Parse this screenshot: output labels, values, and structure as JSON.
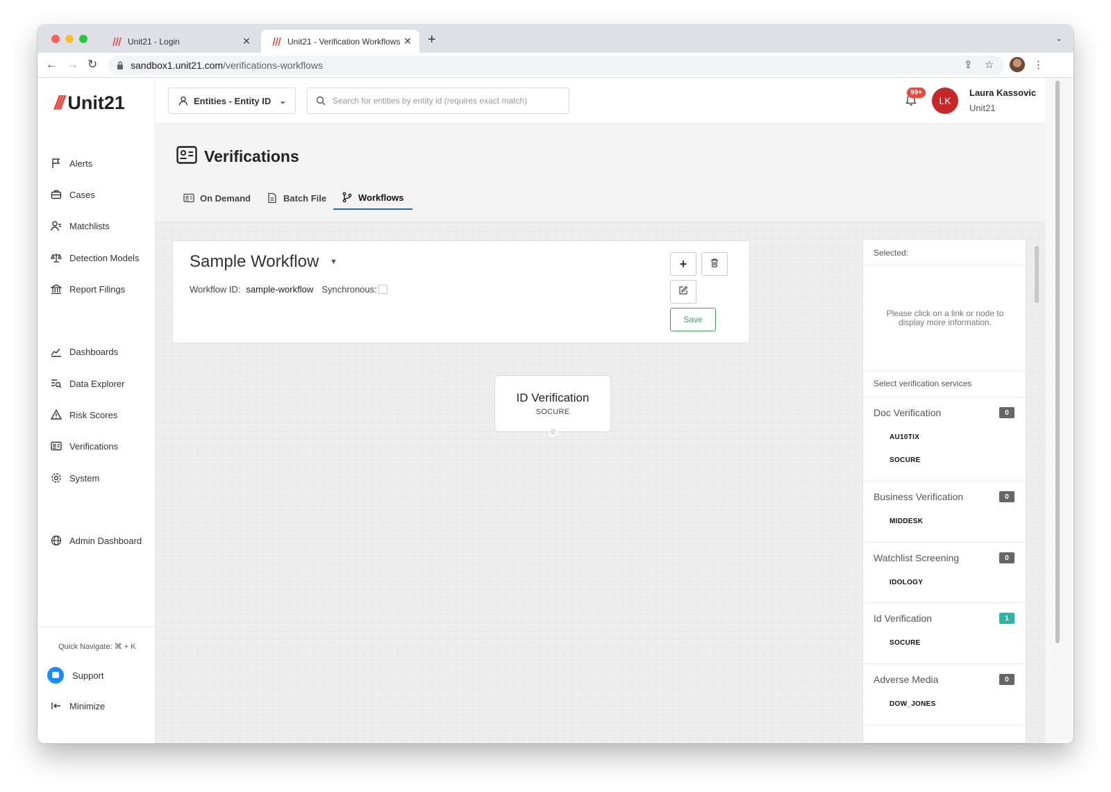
{
  "browser": {
    "tabs": [
      {
        "title": "Unit21 - Login",
        "close": "✕"
      },
      {
        "title": "Unit21 - Verification Workflows",
        "close": "✕"
      }
    ],
    "new_tab": "+",
    "url_host": "sandbox1.unit21.com",
    "url_path": "/verifications-workflows"
  },
  "brand": {
    "name": "Unit21",
    "slashes": "///",
    "accent": "#e8473f"
  },
  "sidebar": {
    "items": [
      {
        "label": "Alerts",
        "icon": "flag-icon"
      },
      {
        "label": "Cases",
        "icon": "briefcase-icon"
      },
      {
        "label": "Matchlists",
        "icon": "user-list-icon"
      },
      {
        "label": "Detection Models",
        "icon": "scale-icon"
      },
      {
        "label": "Report Filings",
        "icon": "bank-icon"
      },
      {
        "label": "Dashboards",
        "icon": "chart-line-icon"
      },
      {
        "label": "Data Explorer",
        "icon": "data-search-icon"
      },
      {
        "label": "Risk Scores",
        "icon": "warning-icon"
      },
      {
        "label": "Verifications",
        "icon": "id-card-icon"
      },
      {
        "label": "System",
        "icon": "gear-icon"
      },
      {
        "label": "Admin Dashboard",
        "icon": "globe-icon"
      }
    ],
    "quick_navigate": "Quick Navigate: ⌘ + K",
    "support": "Support",
    "minimize": "Minimize"
  },
  "header": {
    "entity_select": "Entities - Entity ID",
    "search_placeholder": "Search for entities by entity id (requires exact match)",
    "notifications": "99+",
    "user_initials": "LK",
    "user_name": "Laura Kassovic",
    "user_org": "Unit21"
  },
  "page": {
    "title": "Verifications",
    "tabs": [
      {
        "label": "On Demand"
      },
      {
        "label": "Batch File"
      },
      {
        "label": "Workflows"
      }
    ]
  },
  "workflow": {
    "name": "Sample Workflow",
    "id_label": "Workflow ID:",
    "id_value": "sample-workflow",
    "sync_label": "Synchronous:",
    "save": "Save"
  },
  "node": {
    "title": "ID Verification",
    "provider": "SOCURE"
  },
  "panel": {
    "selected_label": "Selected:",
    "empty_message": "Please click on a link or node to display more information.",
    "services_label": "Select verification services",
    "services": [
      {
        "name": "Doc Verification",
        "count": "0",
        "providers": [
          "AU10TIX",
          "SOCURE"
        ]
      },
      {
        "name": "Business Verification",
        "count": "0",
        "providers": [
          "MIDDESK"
        ]
      },
      {
        "name": "Watchlist Screening",
        "count": "0",
        "providers": [
          "IDOLOGY"
        ]
      },
      {
        "name": "Id Verification",
        "count": "1",
        "providers": [
          "SOCURE"
        ]
      },
      {
        "name": "Adverse Media",
        "count": "0",
        "providers": [
          "DOW_JONES"
        ]
      }
    ]
  }
}
